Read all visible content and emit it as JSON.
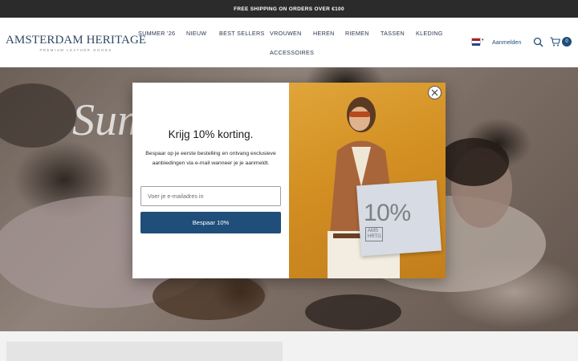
{
  "announcement": "FREE SHIPPING ON ORDERS OVER €100",
  "brand": {
    "name": "AMSTERDAM HERITAGE",
    "tagline": "PREMIUM LEATHER GOODS"
  },
  "nav": {
    "items": [
      "SUMMER '26",
      "NIEUW",
      "BEST SELLERS",
      "VROUWEN",
      "HEREN",
      "RIEMEN",
      "TASSEN",
      "KLEDING",
      "ACCESSOIRES"
    ]
  },
  "header": {
    "login_label": "Aanmelden",
    "cart_count": "0",
    "country_flag": "netherlands-flag-icon"
  },
  "hero": {
    "script_text": "Sum"
  },
  "popup": {
    "title": "Krijg 10% korting.",
    "description": "Bespaar op je eerste bestelling en ontvang exclusieve aanbiedingen via e-mail wanneer je je aanmeldt.",
    "email_placeholder": "Voer je e-mailadres in",
    "email_value": "",
    "submit_label": "Bespaar 10%",
    "promo_percent": "10%",
    "promo_brand_line1": "AMS",
    "promo_brand_line2": "HRTG"
  },
  "colors": {
    "primary": "#1f4e7a",
    "announcement_bg": "#2b2b2b",
    "popup_image_bg": "#d38f22"
  },
  "icons": {
    "search": "search-icon",
    "cart": "cart-icon",
    "close": "close-icon"
  }
}
